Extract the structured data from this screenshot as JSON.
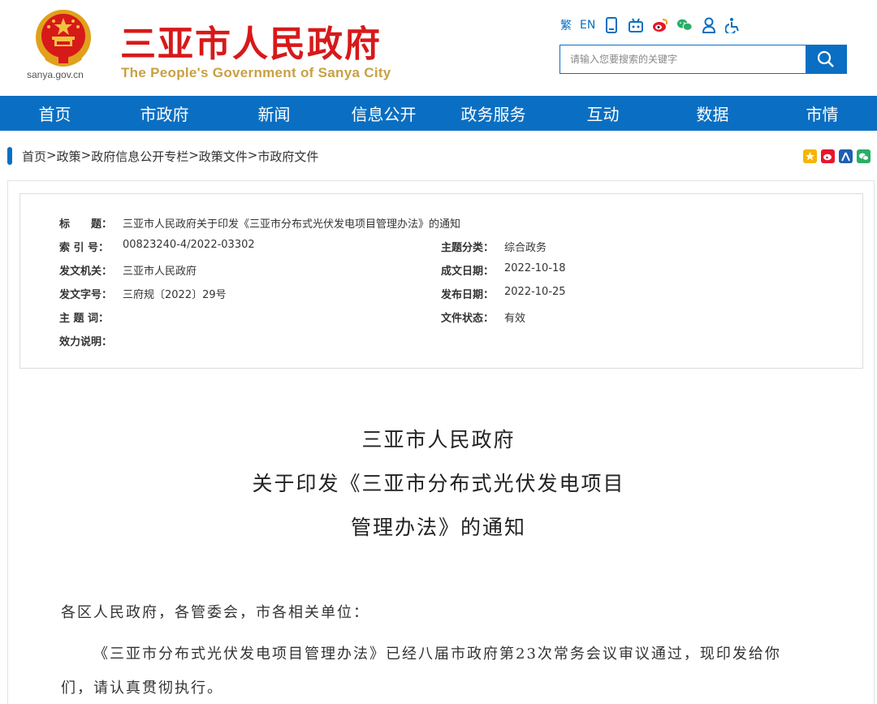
{
  "header": {
    "domain": "sanya.gov.cn",
    "title_cn": "三亚市人民政府",
    "title_en": "The People's Government of Sanya City",
    "links": [
      {
        "label": "繁"
      },
      {
        "label": "EN"
      }
    ],
    "icons": [
      "mobile-icon",
      "robot-icon",
      "weibo-icon",
      "wechat-icon",
      "user-icon",
      "accessibility-icon"
    ],
    "search_placeholder": "请输入您要搜索的关键字"
  },
  "nav": {
    "items": [
      "首页",
      "市政府",
      "新闻",
      "信息公开",
      "政务服务",
      "互动",
      "数据",
      "市情"
    ]
  },
  "breadcrumb": {
    "items": [
      "首页",
      "政策",
      "政府信息公开专栏",
      "政策文件",
      "市政府文件"
    ],
    "separator": ">"
  },
  "share_icons": [
    "qzone-icon",
    "weibo-share-icon",
    "renren-icon",
    "wechat-share-icon"
  ],
  "meta": {
    "title_label": "标　　题：",
    "title_value": "三亚市人民政府关于印发《三亚市分布式光伏发电项目管理办法》的通知",
    "index_label": "索 引 号：",
    "index_value": "00823240-4/2022-03302",
    "topic_label": "主题分类：",
    "topic_value": "综合政务",
    "issuer_label": "发文机关：",
    "issuer_value": "三亚市人民政府",
    "written_label": "成文日期：",
    "written_value": "2022-10-18",
    "docno_label": "发文字号：",
    "docno_value": "三府规〔2022〕29号",
    "published_label": "发布日期：",
    "published_value": "2022-10-25",
    "keywords_label": "主 题 词：",
    "keywords_value": "",
    "status_label": "文件状态：",
    "status_value": "有效",
    "validity_label": "效力说明：",
    "validity_value": ""
  },
  "document": {
    "title_line1": "三亚市人民政府",
    "title_line2": "关于印发《三亚市分布式光伏发电项目",
    "title_line3": "管理办法》的通知",
    "salutation": "各区人民政府，各管委会，市各相关单位：",
    "body_line1": "《三亚市分布式光伏发电项目管理办法》已经八届市政府第23次常务会议审议通过，现印发给你",
    "body_line2": "们，请认真贯彻执行。"
  },
  "colors": {
    "brand_red": "#d7191a",
    "brand_blue": "#0a6fc2",
    "gold": "#c8a043"
  }
}
